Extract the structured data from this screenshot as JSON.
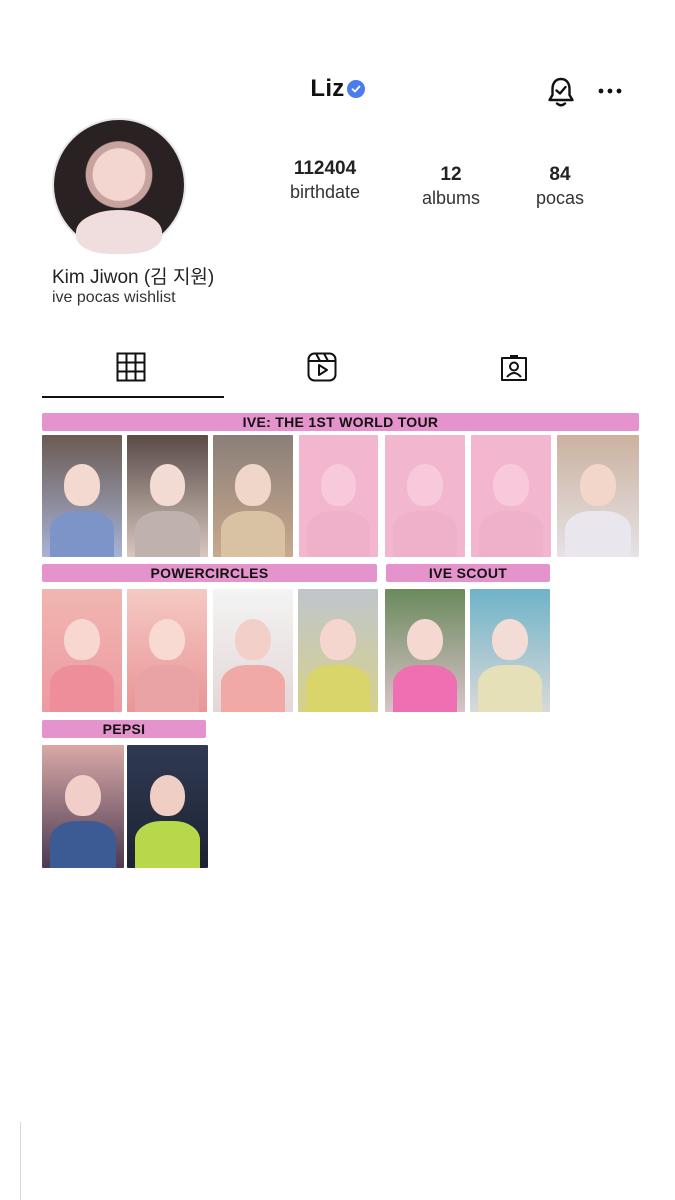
{
  "profile": {
    "username": "Liz",
    "display_name": "Kim Jiwon",
    "display_name_korean": "(김 지원)",
    "bio": "ive pocas wishlist"
  },
  "stats": [
    {
      "value": "112404",
      "label": "birthdate"
    },
    {
      "value": "12",
      "label": "albums"
    },
    {
      "value": "84",
      "label": "pocas"
    }
  ],
  "header_icons": [
    "bell-check-icon",
    "more-horizontal-icon"
  ],
  "tabs": [
    {
      "name": "grid-icon",
      "selected": true
    },
    {
      "name": "reels-icon",
      "selected": false
    },
    {
      "name": "tagged-icon",
      "selected": false
    }
  ],
  "sections": {
    "world_tour": "IVE: THE 1ST WORLD TOUR",
    "powercircles": "POWERCIRCLES",
    "ive_scout": "IVE SCOUT",
    "pepsi": "PEPSI"
  },
  "colors": {
    "band": "#e593cc",
    "verified": "#4a7bf0",
    "wish_overlay": "#f2b6cf"
  }
}
